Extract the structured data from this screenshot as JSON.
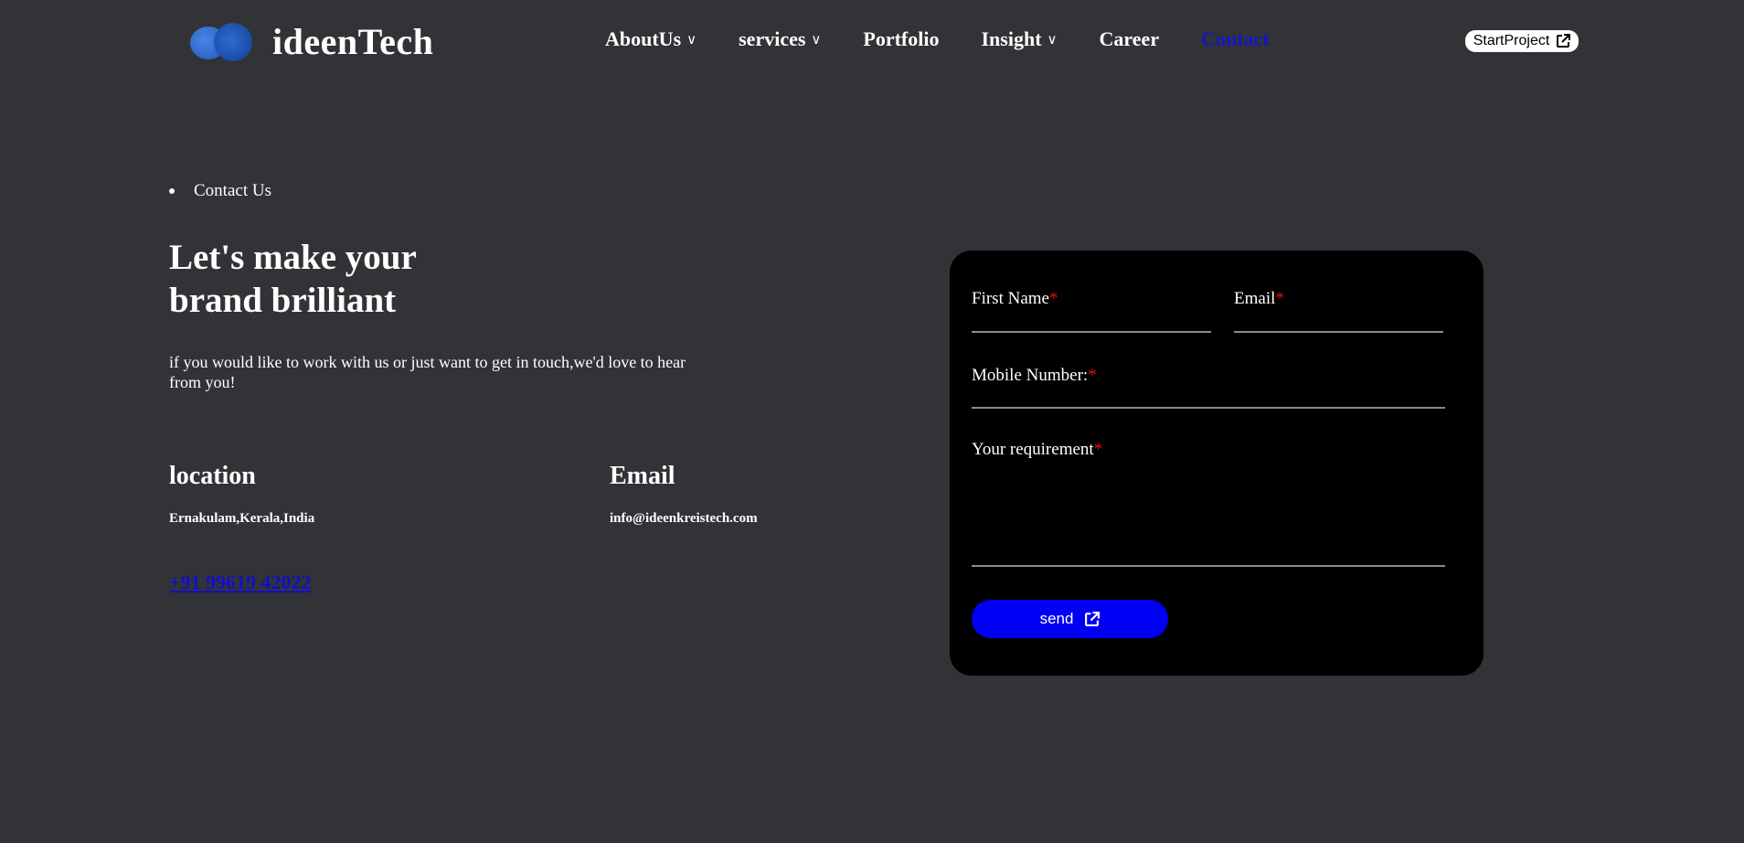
{
  "header": {
    "brand": "ideenTech",
    "nav": [
      {
        "label": "AboutUs",
        "dropdown": true
      },
      {
        "label": "services",
        "dropdown": true
      },
      {
        "label": "Portfolio",
        "dropdown": false
      },
      {
        "label": "Insight",
        "dropdown": true
      },
      {
        "label": "Career",
        "dropdown": false
      },
      {
        "label": "Contact",
        "dropdown": false,
        "active": true
      }
    ],
    "chevron": "∨",
    "cta_label": "StartProject"
  },
  "breadcrumb": "Contact Us",
  "hero": {
    "title_line1": "Let's make your",
    "title_line2": "brand brilliant",
    "intro": "if you would like to work with us or just want to get in touch,we'd love to hear from you!"
  },
  "location": {
    "title": "location",
    "value": "Ernakulam,Kerala,India"
  },
  "email": {
    "title": "Email",
    "value": "info@ideenkreistech.com"
  },
  "phone": "+91 99619 42022",
  "form": {
    "first_name_label": "First Name",
    "email_label": "Email",
    "mobile_label": "Mobile Number:",
    "requirement_label": "Your requirement",
    "required_mark": "*",
    "send_label": "send"
  },
  "colors": {
    "background": "#323336",
    "card": "#000000",
    "accent": "#0000f5",
    "active_nav": "#1515cc",
    "required": "#e11010"
  },
  "icons": [
    "external-link-icon",
    "chevron-down-icon",
    "logo-icon"
  ]
}
